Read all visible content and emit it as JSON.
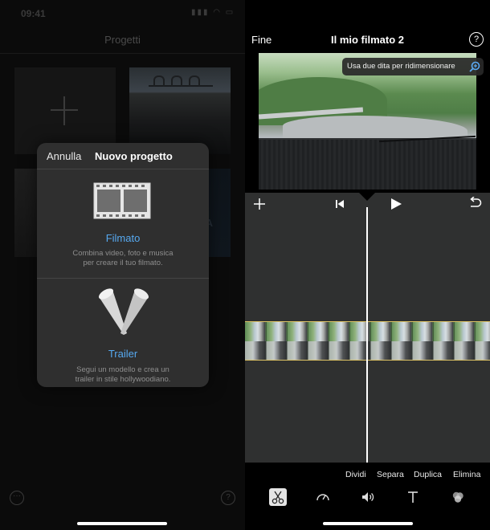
{
  "left": {
    "status_time": "09:41",
    "status_icons": "▮▮▮ ◠ ▭",
    "title": "Progetti",
    "ghost_letter": "A",
    "more_glyph": "···",
    "help_glyph": "?"
  },
  "popup": {
    "cancel": "Annulla",
    "title": "Nuovo progetto",
    "movie": {
      "title": "Filmato",
      "desc_line1": "Combina video, foto e musica",
      "desc_line2": "per creare il tuo filmato."
    },
    "trailer": {
      "title": "Trailer",
      "desc_line1": "Segui un modello e crea un",
      "desc_line2": "trailer in stile hollywoodiano."
    }
  },
  "right": {
    "done": "Fine",
    "title": "Il mio filmato 2",
    "help_glyph": "?",
    "tooltip": "Usa due dita per ridimensionare",
    "actions": [
      "Dividi",
      "Separa",
      "Duplica",
      "Elimina"
    ],
    "tools": [
      "scissors-icon",
      "speedometer-icon",
      "volume-icon",
      "text-icon",
      "filters-icon"
    ]
  },
  "colors": {
    "accent": "#56a9f0",
    "timeline_border": "#d9bf63",
    "popup_bg": "#2f2f2f",
    "editor_bg": "#2f3030"
  }
}
